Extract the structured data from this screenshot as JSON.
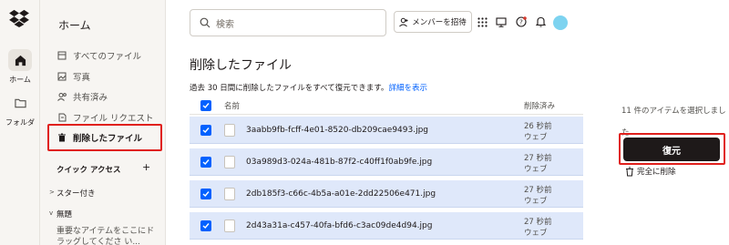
{
  "rail": {
    "items": [
      {
        "label": "ホーム",
        "icon": "home-icon"
      },
      {
        "label": "フォルダ",
        "icon": "folder-icon"
      }
    ]
  },
  "nav": {
    "title": "ホーム",
    "items": [
      {
        "label": "すべてのファイル",
        "icon": "files-icon"
      },
      {
        "label": "写真",
        "icon": "photo-icon"
      },
      {
        "label": "共有済み",
        "icon": "shared-icon"
      },
      {
        "label": "ファイル リクエスト",
        "icon": "file-request-icon"
      },
      {
        "label": "削除したファイル",
        "icon": "trash-icon"
      }
    ],
    "quick_access": "クイック アクセス",
    "starred": "スター付き",
    "untitled": "無題",
    "note": "重要なアイテムをここにドラッグしてくださ い..."
  },
  "topbar": {
    "search_placeholder": "検索",
    "invite_label": "メンバーを招待"
  },
  "main": {
    "title": "削除したファイル",
    "description": "過去 30 日間に削除したファイルをすべて復元できます。",
    "details_link": "詳細を表示",
    "col_name": "名前",
    "col_deleted": "削除済み",
    "rows": [
      {
        "name": "3aabb9fb-fcff-4e01-8520-db209cae9493.jpg",
        "time": "26 秒前",
        "source": "ウェブ"
      },
      {
        "name": "03a989d3-024a-481b-87f2-c40ff1f0ab9fe.jpg",
        "time": "27 秒前",
        "source": "ウェブ"
      },
      {
        "name": "2db185f3-c66c-4b5a-a01e-2dd22506e471.jpg",
        "time": "27 秒前",
        "source": "ウェブ"
      },
      {
        "name": "2d43a31a-c457-40fa-bfd6-c3ac09de4d94.jpg",
        "time": "27 秒前",
        "source": "ウェブ"
      }
    ]
  },
  "panel": {
    "selection_info": "11 件のアイテムを選択しました",
    "restore_label": "復元",
    "delete_label": "完全に削除"
  },
  "colors": {
    "accent": "#0061fe",
    "highlight": "#e0201c",
    "row_bg": "#dfe8fa",
    "dark_button": "#1e1919"
  }
}
